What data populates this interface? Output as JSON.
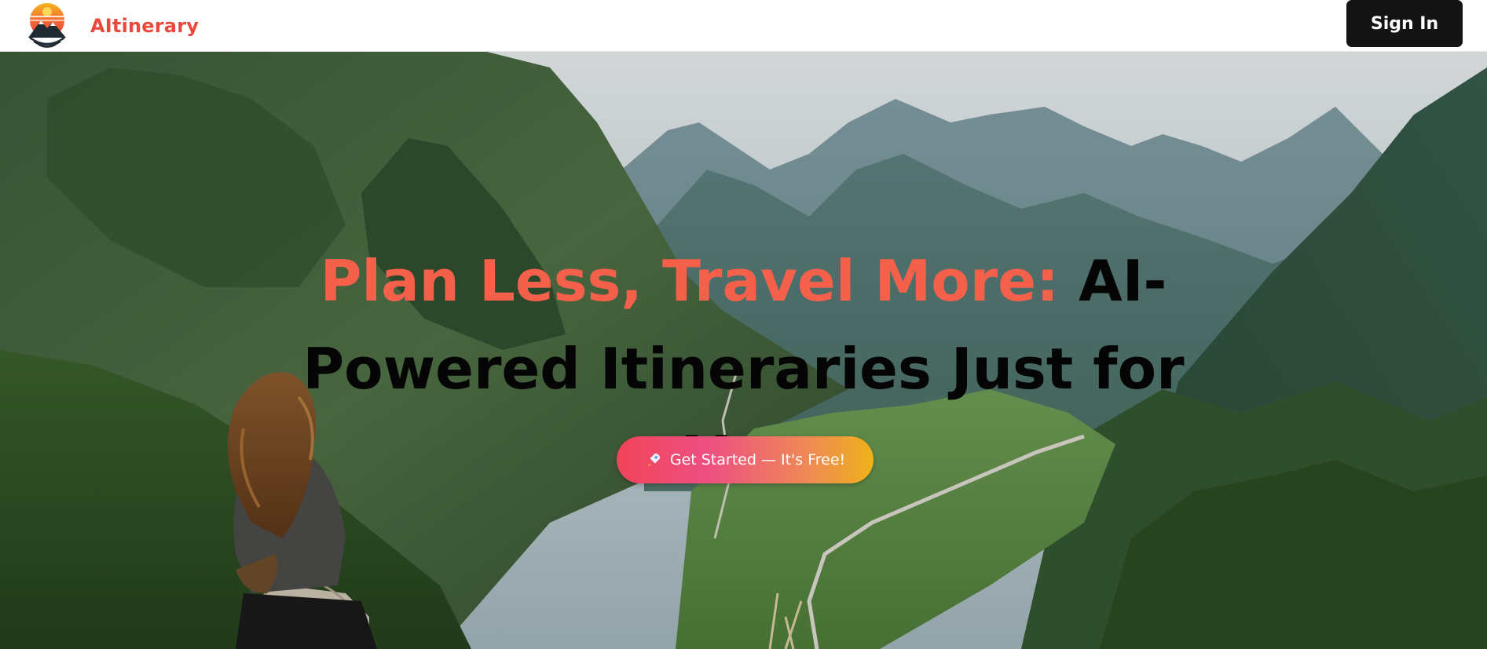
{
  "brand": {
    "name": "AItinerary"
  },
  "nav": {
    "signin_label": "Sign In"
  },
  "hero": {
    "headline_accent": "Plan Less, Travel More:",
    "headline_rest": "AI-Powered Itineraries Just for You",
    "cta_label": "Get Started — It's Free!",
    "cta_icon": "rocket-icon"
  },
  "colors": {
    "brand": "#e8493b",
    "accent": "#f4604a",
    "signin_bg": "#141414",
    "cta_gradient": [
      "#f04458",
      "#ee4f83",
      "#ef8a54",
      "#efb21a"
    ]
  }
}
